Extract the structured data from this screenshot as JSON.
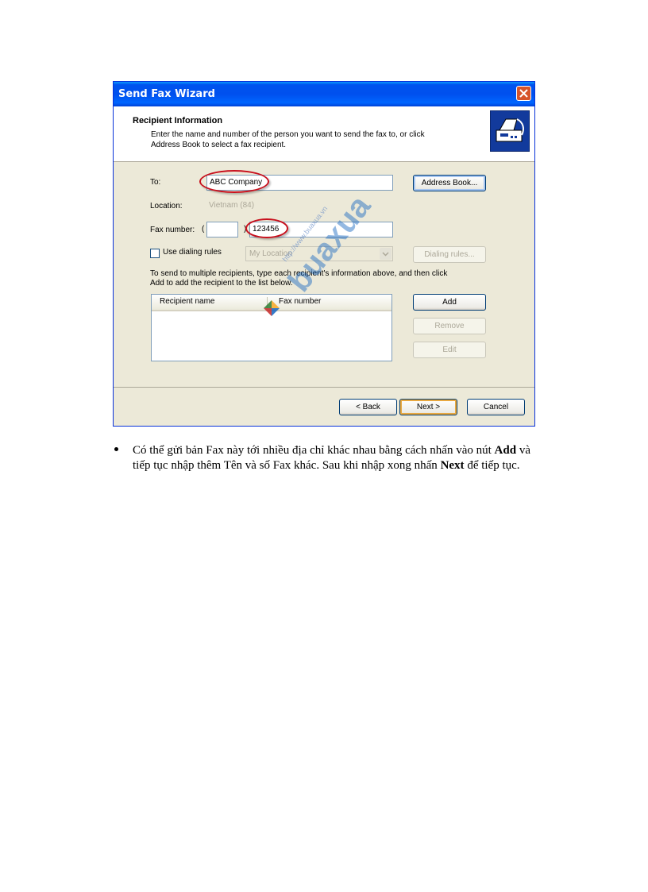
{
  "window": {
    "title": "Send Fax Wizard"
  },
  "header": {
    "title": "Recipient Information",
    "subtitle": "Enter the name and number of the person you want to send the fax to, or click Address Book to select a fax recipient."
  },
  "form": {
    "to_label": "To:",
    "to_value": "ABC Company",
    "location_label": "Location:",
    "location_value": "Vietnam (84)",
    "fax_label": "Fax number:",
    "fax_paren_open": "(",
    "fax_paren_close": ")",
    "fax_area_value": "",
    "fax_value": "123456",
    "dialing_label": "Use dialing rules",
    "dialing_location": "My Location",
    "multi_text": "To send to multiple recipients, type each recipient's information above, and then click Add to add the recipient to the list below."
  },
  "list": {
    "columns": [
      "Recipient name",
      "Fax number"
    ]
  },
  "buttons": {
    "address_book": "Address Book...",
    "dialing_rules": "Dialing rules...",
    "add": "Add",
    "remove": "Remove",
    "edit": "Edit",
    "back": "< Back",
    "next": "Next >",
    "cancel": "Cancel"
  },
  "watermark": {
    "url": "http://www.buaxua.vn",
    "text": "buaxua",
    "colors": [
      "#2e7d32",
      "#1565c0",
      "#c62828",
      "#f9a825"
    ]
  },
  "doc": {
    "p1": "Có thể gửi bản Fax này tới nhiều địa chỉ khác nhau bằng cách nhấn vào nút ",
    "b1": "Add",
    "p2": " và tiếp tục nhập thêm Tên và số Fax khác. Sau khi nhập xong nhấn ",
    "b2": "Next",
    "p3": " để tiếp tục."
  },
  "colors": {
    "highlight": "#c8101d",
    "titlebar": "#0053ee"
  }
}
